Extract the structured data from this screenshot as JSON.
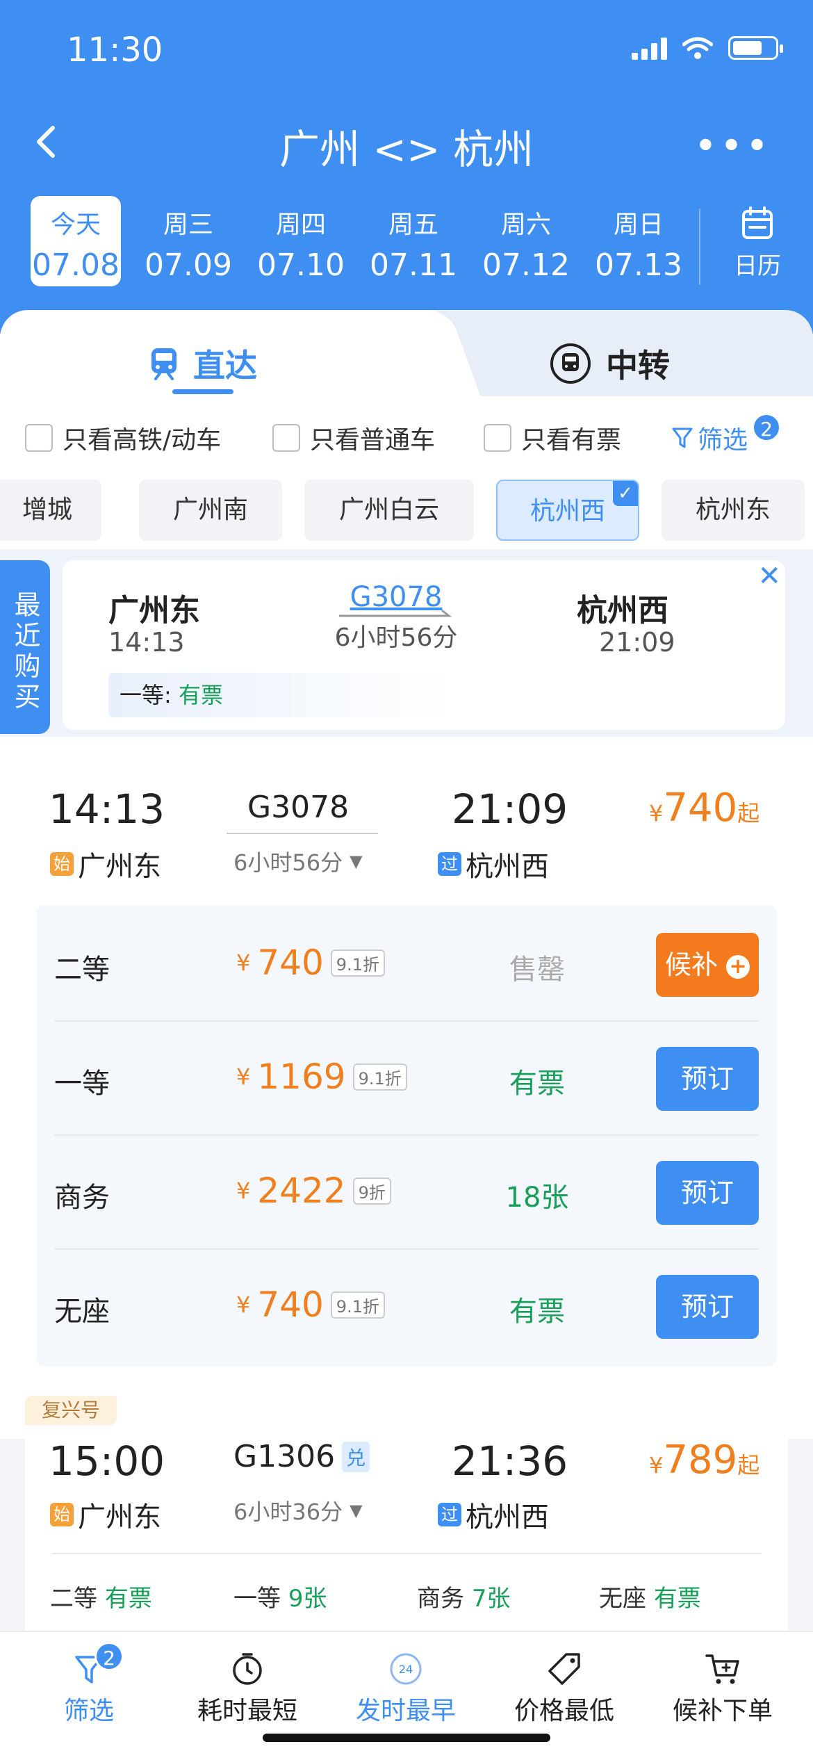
{
  "status": {
    "time": "11:30"
  },
  "header": {
    "title": "广州 <> 杭州",
    "more": "•••"
  },
  "dates": [
    {
      "weekday": "今天",
      "date": "07.08",
      "active": true
    },
    {
      "weekday": "周三",
      "date": "07.09"
    },
    {
      "weekday": "周四",
      "date": "07.10"
    },
    {
      "weekday": "周五",
      "date": "07.11"
    },
    {
      "weekday": "周六",
      "date": "07.12"
    },
    {
      "weekday": "周日",
      "date": "07.13"
    }
  ],
  "calendar_label": "日历",
  "tabs": {
    "direct": "直达",
    "transfer": "中转"
  },
  "filters": {
    "high_speed": "只看高铁/动车",
    "normal": "只看普通车",
    "available": "只看有票",
    "filter_label": "筛选",
    "filter_count": "2"
  },
  "stations": [
    "增城",
    "广州南",
    "广州白云",
    "杭州西",
    "杭州东"
  ],
  "recent": {
    "tag": "最近购买",
    "from": "广州东",
    "from_time": "14:13",
    "train": "G3078",
    "duration": "6小时56分",
    "to": "杭州西",
    "to_time": "21:09",
    "seat_label": "一等:",
    "seat_status": "有票"
  },
  "train1": {
    "dep_time": "14:13",
    "dep_station": "广州东",
    "dep_tag": "始",
    "train_no": "G3078",
    "duration": "6小时56分",
    "arr_time": "21:09",
    "arr_station": "杭州西",
    "arr_tag": "过",
    "price_cur": "¥",
    "price": "740",
    "price_suffix": "起",
    "seats": [
      {
        "name": "二等",
        "cur": "¥",
        "price": "740",
        "discount": "9.1折",
        "status": "售罄",
        "button": "候补"
      },
      {
        "name": "一等",
        "cur": "¥",
        "price": "1169",
        "discount": "9.1折",
        "status": "有票",
        "button": "预订"
      },
      {
        "name": "商务",
        "cur": "¥",
        "price": "2422",
        "discount": "9折",
        "status": "18张",
        "button": "预订"
      },
      {
        "name": "无座",
        "cur": "¥",
        "price": "740",
        "discount": "9.1折",
        "status": "有票",
        "button": "预订"
      }
    ]
  },
  "train2": {
    "tag": "复兴号",
    "dep_time": "15:00",
    "dep_station": "广州东",
    "dep_tag": "始",
    "train_no": "G1306",
    "train_badge": "兑",
    "duration": "6小时36分",
    "arr_time": "21:36",
    "arr_station": "杭州西",
    "arr_tag": "过",
    "price_cur": "¥",
    "price": "789",
    "price_suffix": "起",
    "seats": [
      {
        "name": "二等",
        "status": "有票"
      },
      {
        "name": "一等",
        "status": "9张"
      },
      {
        "name": "商务",
        "status": "7张"
      },
      {
        "name": "无座",
        "status": "有票"
      }
    ]
  },
  "bottom_bar": {
    "filter": "筛选",
    "filter_count": "2",
    "shortest": "耗时最短",
    "earliest": "发时最早",
    "earliest_icon_text": "24",
    "cheapest": "价格最低",
    "waitlist": "候补下单"
  }
}
